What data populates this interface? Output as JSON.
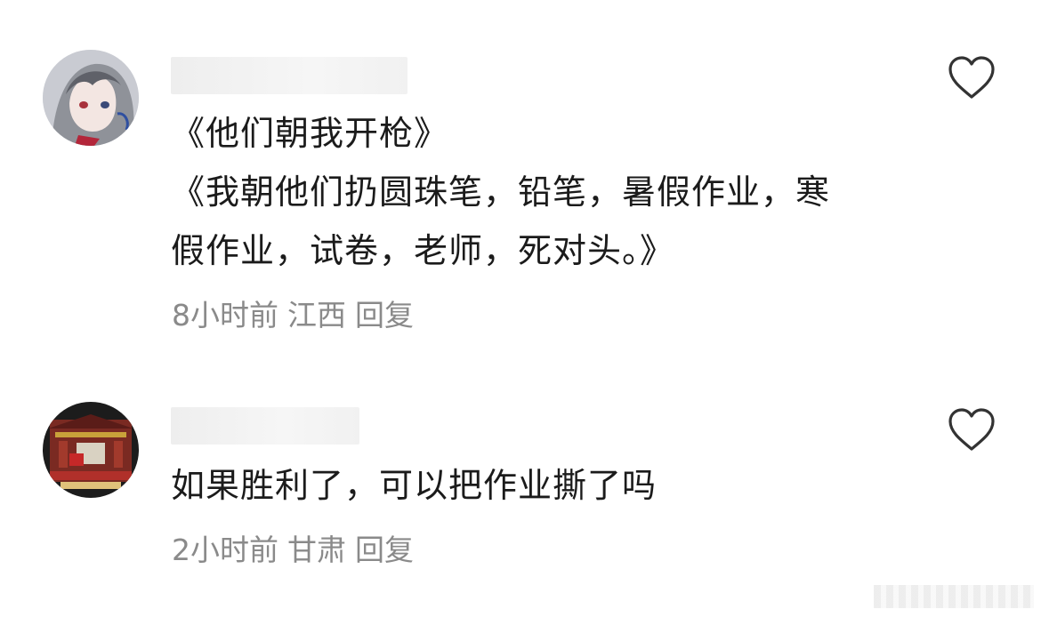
{
  "comments": [
    {
      "avatar_icon": "anime-character-avatar",
      "lines": [
        "《他们朝我开枪》",
        "《我朝他们扔圆珠笔，铅笔，暑假作业，寒",
        "假作业，试卷，老师，死对头。》"
      ],
      "time": "8小时前",
      "location": "江西",
      "reply_label": "回复",
      "like_icon": "heart-outline-icon"
    },
    {
      "avatar_icon": "tiananmen-avatar",
      "lines": [
        "如果胜利了，可以把作业撕了吗"
      ],
      "time": "2小时前",
      "location": "甘肃",
      "reply_label": "回复",
      "like_icon": "heart-outline-icon"
    }
  ],
  "colors": {
    "text": "#1b1b1b",
    "meta": "#8a8a8a",
    "icon": "#333333"
  }
}
